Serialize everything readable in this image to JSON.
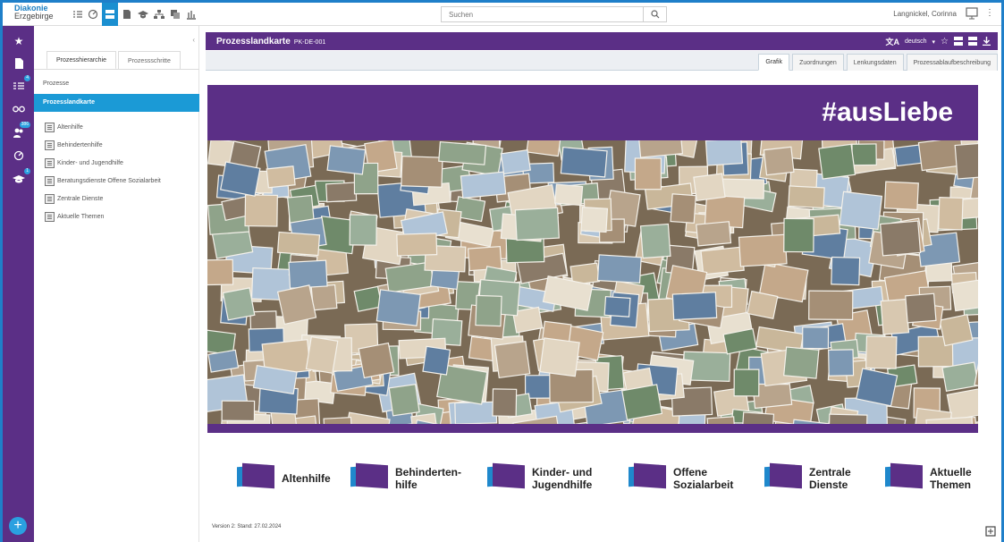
{
  "app": {
    "logo_line1": "Diakonie",
    "logo_line2": "Erzgebirge"
  },
  "toolbar": {
    "icons": [
      "list-check-icon",
      "gauge-icon",
      "layout-icon",
      "document-icon",
      "graduation-cap-icon",
      "org-chart-icon",
      "copy-icon",
      "bar-chart-icon"
    ]
  },
  "search": {
    "placeholder": "Suchen"
  },
  "user": {
    "name": "Langnickel, Corinna"
  },
  "leftnav": {
    "items": [
      {
        "icon": "star-icon",
        "badge": ""
      },
      {
        "icon": "document-icon",
        "badge": ""
      },
      {
        "icon": "tasks-icon",
        "badge": "4"
      },
      {
        "icon": "glasses-icon",
        "badge": ""
      },
      {
        "icon": "users-icon",
        "badge": "386"
      },
      {
        "icon": "gauge-icon",
        "badge": ""
      },
      {
        "icon": "graduation-cap-icon",
        "badge": "1"
      }
    ],
    "add_label": "+"
  },
  "sidebar": {
    "tabs": [
      "Prozesshierarchie",
      "Prozessschritte"
    ],
    "root": "Prozesse",
    "selected": "Prozesslandkarte",
    "items": [
      "Altenhilfe",
      "Behindertenhilfe",
      "Kinder- und Jugendhilfe",
      "Beratungsdienste Offene Sozialarbeit",
      "Zentrale Dienste",
      "Aktuelle Themen"
    ]
  },
  "main": {
    "title": "Prozesslandkarte",
    "id": "PK-DE-001",
    "language": "deutsch",
    "tabs": [
      "Grafik",
      "Zuordnungen",
      "Lenkungsdaten",
      "Prozessablaufbeschreibung"
    ],
    "active_tab": "Grafik"
  },
  "graphic": {
    "hashtag": "#ausLiebe",
    "categories": [
      {
        "line1": "Altenhilfe",
        "line2": ""
      },
      {
        "line1": "Behinderten-",
        "line2": "hilfe"
      },
      {
        "line1": "Kinder- und",
        "line2": "Jugendhilfe"
      },
      {
        "line1": "Offene",
        "line2": "Sozialarbeit"
      },
      {
        "line1": "Zentrale",
        "line2": "Dienste"
      },
      {
        "line1": "Aktuelle",
        "line2": "Themen"
      }
    ],
    "version": "Version 2: Stand: 27.02.2024"
  },
  "colors": {
    "purple": "#5b2f86",
    "blue": "#1b9ad6",
    "frame": "#1f7fc9"
  }
}
